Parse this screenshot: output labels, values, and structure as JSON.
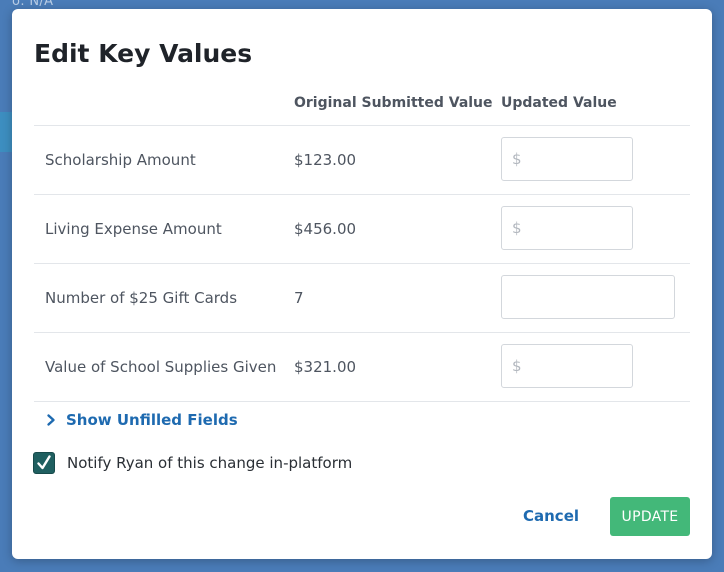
{
  "backdrop": {
    "fragment_text": "o: N/A"
  },
  "modal": {
    "title": "Edit Key Values",
    "columns": {
      "original": "Original Submitted Value",
      "updated": "Updated Value"
    },
    "rows": [
      {
        "label": "Scholarship Amount",
        "original": "$123.00",
        "placeholder": "$",
        "value": ""
      },
      {
        "label": "Living Expense Amount",
        "original": "$456.00",
        "placeholder": "$",
        "value": ""
      },
      {
        "label": "Number of $25 Gift Cards",
        "original": "7",
        "placeholder": "",
        "value": ""
      },
      {
        "label": "Value of School Supplies Given",
        "original": "$321.00",
        "placeholder": "$",
        "value": ""
      }
    ],
    "show_unfilled_label": "Show Unfilled Fields",
    "show_unfilled_icon": "chevron-right-icon",
    "notify": {
      "label": "Notify Ryan of this change in-platform",
      "checked": true
    },
    "cancel_label": "Cancel",
    "update_label": "UPDATE"
  },
  "colors": {
    "backdrop": "#4a7cb8",
    "link": "#1e6ab0",
    "primary_button": "#43b879",
    "checkbox": "#1f5f60"
  }
}
